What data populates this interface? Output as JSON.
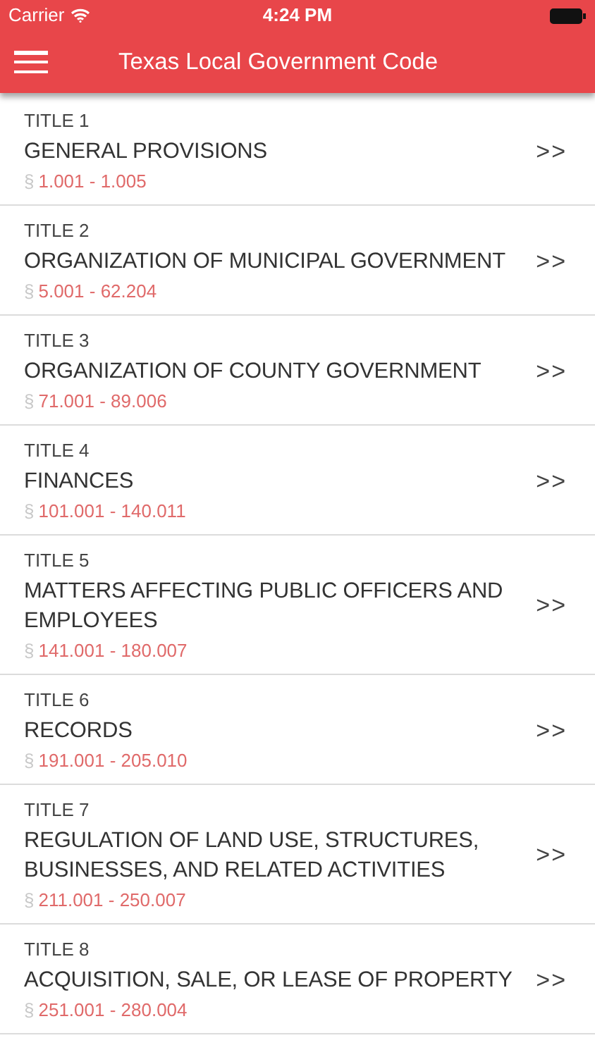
{
  "status_bar": {
    "carrier": "Carrier",
    "time": "4:24 PM"
  },
  "nav_bar": {
    "title": "Texas Local Government Code"
  },
  "titles": [
    {
      "label": "TITLE 1",
      "name": "GENERAL PROVISIONS",
      "section_sign": "§",
      "range": "1.001 - 1.005",
      "chevron": ">>"
    },
    {
      "label": "TITLE 2",
      "name": "ORGANIZATION OF MUNICIPAL GOVERNMENT",
      "section_sign": "§",
      "range": "5.001 - 62.204",
      "chevron": ">>"
    },
    {
      "label": "TITLE 3",
      "name": "ORGANIZATION OF COUNTY GOVERNMENT",
      "section_sign": "§",
      "range": "71.001 - 89.006",
      "chevron": ">>"
    },
    {
      "label": "TITLE 4",
      "name": "FINANCES",
      "section_sign": "§",
      "range": "101.001 - 140.011",
      "chevron": ">>"
    },
    {
      "label": "TITLE 5",
      "name": "MATTERS AFFECTING PUBLIC OFFICERS AND EMPLOYEES",
      "section_sign": "§",
      "range": "141.001 - 180.007",
      "chevron": ">>"
    },
    {
      "label": "TITLE 6",
      "name": "RECORDS",
      "section_sign": "§",
      "range": "191.001 - 205.010",
      "chevron": ">>"
    },
    {
      "label": "TITLE 7",
      "name": "REGULATION OF LAND USE, STRUCTURES, BUSINESSES, AND RELATED ACTIVITIES",
      "section_sign": "§",
      "range": "211.001 - 250.007",
      "chevron": ">>"
    },
    {
      "label": "TITLE 8",
      "name": "ACQUISITION, SALE, OR LEASE OF PROPERTY",
      "section_sign": "§",
      "range": "251.001 - 280.004",
      "chevron": ">>"
    }
  ]
}
